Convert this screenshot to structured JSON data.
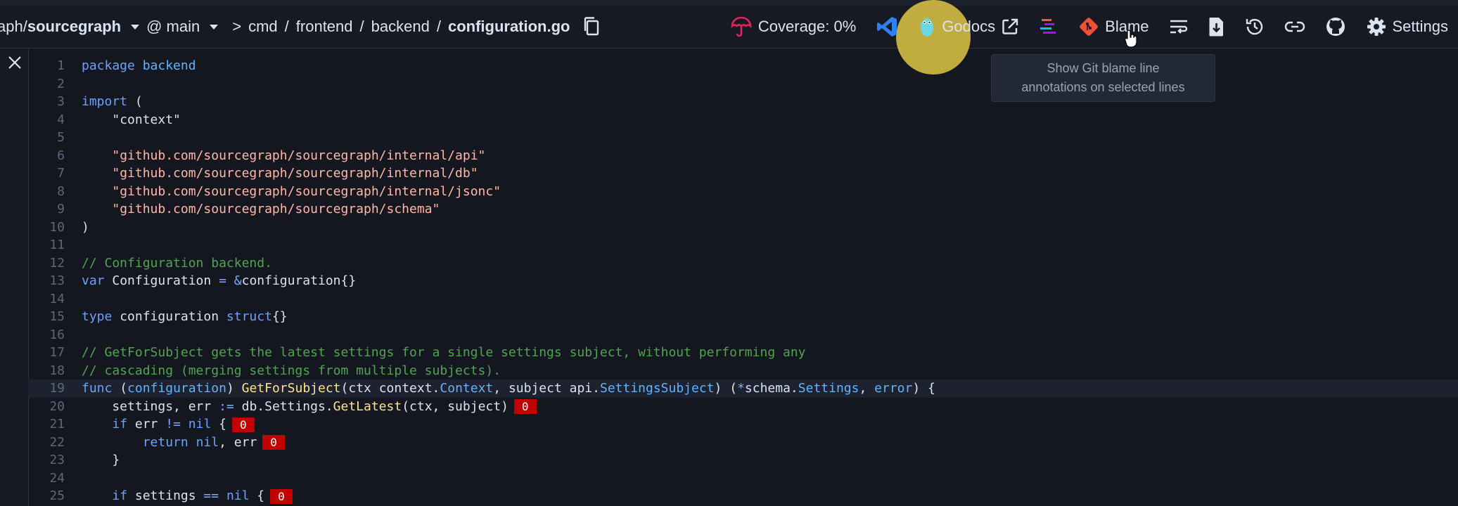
{
  "breadcrumb": {
    "repo_prefix": "aph/",
    "repo_name": "sourcegraph",
    "revision_at": "@ main",
    "path_sep": ">",
    "segments": [
      "cmd",
      "frontend",
      "backend"
    ],
    "file": "configuration.go"
  },
  "toolbar": {
    "coverage_label": "Coverage: 0%",
    "godocs_label": "Godocs",
    "blame_label": "Blame",
    "settings_label": "Settings"
  },
  "tooltip": {
    "line1": "Show Git blame line",
    "line2": "annotations on selected lines"
  },
  "colors": {
    "coverage_accent": "#e0245e",
    "vscode_blue": "#2f80ed",
    "git_red": "#f05133",
    "highlight": "#e6cd46",
    "badge_red": "#c10000"
  },
  "code": {
    "language": "go",
    "lines": [
      {
        "n": "1",
        "tokens": [
          {
            "t": "package",
            "c": "kw"
          },
          {
            "t": " "
          },
          {
            "t": "backend",
            "c": "typ"
          }
        ]
      },
      {
        "n": "2",
        "tokens": []
      },
      {
        "n": "3",
        "tokens": [
          {
            "t": "import",
            "c": "kw"
          },
          {
            "t": " ("
          }
        ]
      },
      {
        "n": "4",
        "tokens": [
          {
            "t": "    "
          },
          {
            "t": "\"context\""
          }
        ]
      },
      {
        "n": "5",
        "tokens": []
      },
      {
        "n": "6",
        "tokens": [
          {
            "t": "    "
          },
          {
            "t": "\"github.com/sourcegraph/sourcegraph/internal/api\"",
            "c": "str"
          }
        ]
      },
      {
        "n": "7",
        "tokens": [
          {
            "t": "    "
          },
          {
            "t": "\"github.com/sourcegraph/sourcegraph/internal/db\"",
            "c": "str"
          }
        ]
      },
      {
        "n": "8",
        "tokens": [
          {
            "t": "    "
          },
          {
            "t": "\"github.com/sourcegraph/sourcegraph/internal/jsonc\"",
            "c": "str"
          }
        ]
      },
      {
        "n": "9",
        "tokens": [
          {
            "t": "    "
          },
          {
            "t": "\"github.com/sourcegraph/sourcegraph/schema\"",
            "c": "str"
          }
        ]
      },
      {
        "n": "10",
        "tokens": [
          {
            "t": ")"
          }
        ]
      },
      {
        "n": "11",
        "tokens": []
      },
      {
        "n": "12",
        "tokens": [
          {
            "t": "// Configuration backend.",
            "c": "com"
          }
        ]
      },
      {
        "n": "13",
        "tokens": [
          {
            "t": "var",
            "c": "kw"
          },
          {
            "t": " Configuration "
          },
          {
            "t": "=",
            "c": "op"
          },
          {
            "t": " "
          },
          {
            "t": "&",
            "c": "op"
          },
          {
            "t": "configuration{}"
          }
        ]
      },
      {
        "n": "14",
        "tokens": []
      },
      {
        "n": "15",
        "tokens": [
          {
            "t": "type",
            "c": "kw"
          },
          {
            "t": " configuration "
          },
          {
            "t": "struct",
            "c": "kw"
          },
          {
            "t": "{}"
          }
        ]
      },
      {
        "n": "16",
        "tokens": []
      },
      {
        "n": "17",
        "tokens": [
          {
            "t": "// GetForSubject gets the latest settings for a single settings subject, without performing any",
            "c": "com"
          }
        ]
      },
      {
        "n": "18",
        "tokens": [
          {
            "t": "// cascading (merging settings from multiple subjects).",
            "c": "com"
          }
        ]
      },
      {
        "n": "19",
        "active": true,
        "tokens": [
          {
            "t": "func",
            "c": "kw"
          },
          {
            "t": " ("
          },
          {
            "t": "configuration",
            "c": "typ"
          },
          {
            "t": ") "
          },
          {
            "t": "GetForSubject",
            "c": "fn"
          },
          {
            "t": "(ctx context."
          },
          {
            "t": "Context",
            "c": "typ"
          },
          {
            "t": ", subject api."
          },
          {
            "t": "SettingsSubject",
            "c": "typ"
          },
          {
            "t": ") ("
          },
          {
            "t": "*",
            "c": "op"
          },
          {
            "t": "schema."
          },
          {
            "t": "Settings",
            "c": "typ"
          },
          {
            "t": ", "
          },
          {
            "t": "error",
            "c": "typ"
          },
          {
            "t": ") {"
          }
        ]
      },
      {
        "n": "20",
        "badge": "0",
        "tokens": [
          {
            "t": "    settings, err "
          },
          {
            "t": ":=",
            "c": "op"
          },
          {
            "t": " db.Settings."
          },
          {
            "t": "GetLatest",
            "c": "fn"
          },
          {
            "t": "(ctx, subject)"
          }
        ]
      },
      {
        "n": "21",
        "badge": "0",
        "tokens": [
          {
            "t": "    "
          },
          {
            "t": "if",
            "c": "kw"
          },
          {
            "t": " err "
          },
          {
            "t": "!=",
            "c": "op"
          },
          {
            "t": " "
          },
          {
            "t": "nil",
            "c": "kw"
          },
          {
            "t": " {"
          }
        ]
      },
      {
        "n": "22",
        "badge": "0",
        "tokens": [
          {
            "t": "        "
          },
          {
            "t": "return",
            "c": "kw"
          },
          {
            "t": " "
          },
          {
            "t": "nil",
            "c": "kw"
          },
          {
            "t": ", err"
          }
        ]
      },
      {
        "n": "23",
        "tokens": [
          {
            "t": "    }"
          }
        ]
      },
      {
        "n": "24",
        "tokens": []
      },
      {
        "n": "25",
        "badge": "0",
        "tokens": [
          {
            "t": "    "
          },
          {
            "t": "if",
            "c": "kw"
          },
          {
            "t": " settings "
          },
          {
            "t": "==",
            "c": "op"
          },
          {
            "t": " "
          },
          {
            "t": "nil",
            "c": "kw"
          },
          {
            "t": " {"
          }
        ]
      }
    ]
  }
}
